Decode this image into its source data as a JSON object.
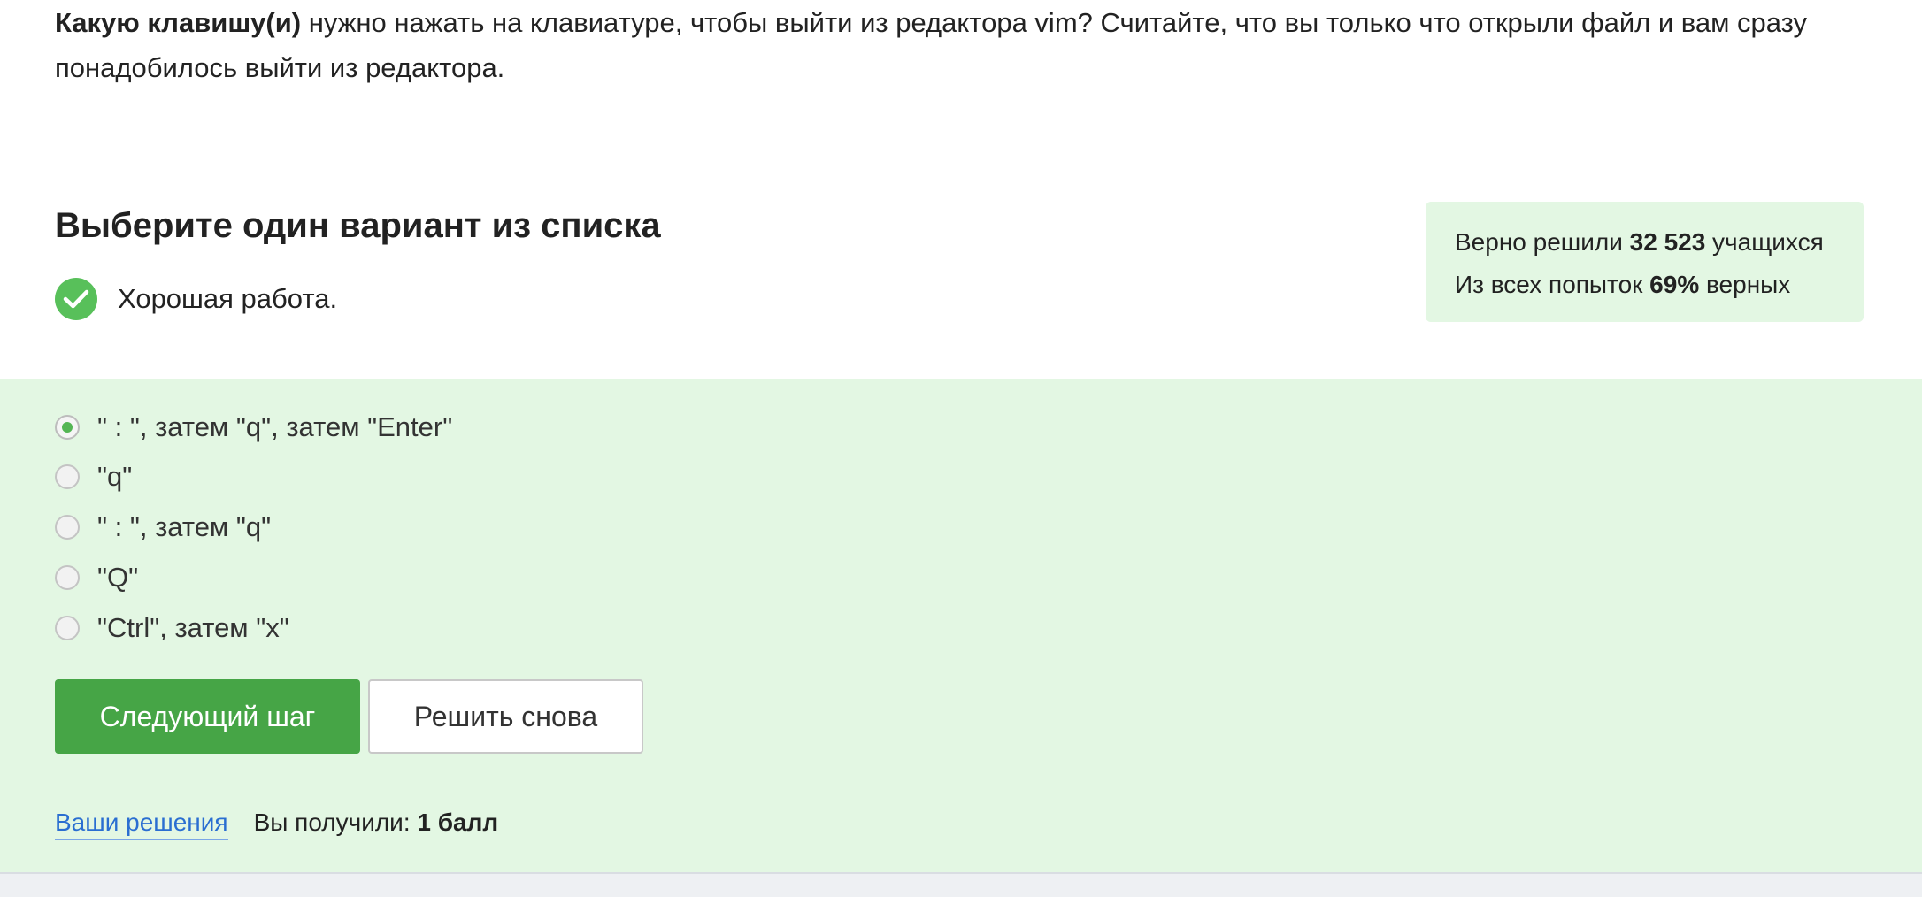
{
  "question": {
    "bold_prefix": "Какую клавишу(и)",
    "text": " нужно нажать на клавиатуре, чтобы выйти из редактора vim? Считайте, что вы только что открыли файл и вам сразу понадобилось выйти из редактора."
  },
  "task": {
    "title": "Выберите один вариант из списка",
    "feedback": "Хорошая работа.",
    "feedback_icon": "check-circle-icon"
  },
  "stats": {
    "line1_prefix": "Верно решили ",
    "solved_count": "32 523",
    "line1_suffix": " учащихся",
    "line2_prefix": "Из всех попыток ",
    "percent": "69%",
    "line2_suffix": " верных"
  },
  "options": [
    {
      "label": "\" : \", затем \"q\", затем \"Enter\"",
      "selected": true
    },
    {
      "label": "\"q\"",
      "selected": false
    },
    {
      "label": "\" : \", затем \"q\"",
      "selected": false
    },
    {
      "label": "\"Q\"",
      "selected": false
    },
    {
      "label": "\"Ctrl\", затем \"x\"",
      "selected": false
    }
  ],
  "buttons": {
    "next": "Следующий шаг",
    "retry": "Решить снова"
  },
  "footer": {
    "solutions_link": "Ваши решения",
    "score_prefix": "Вы получили: ",
    "score_value": "1 балл"
  },
  "colors": {
    "accent_green": "#46a546",
    "success_bg": "#e3f7e3",
    "check_green": "#58c05a",
    "link_blue": "#2a6ed1"
  }
}
